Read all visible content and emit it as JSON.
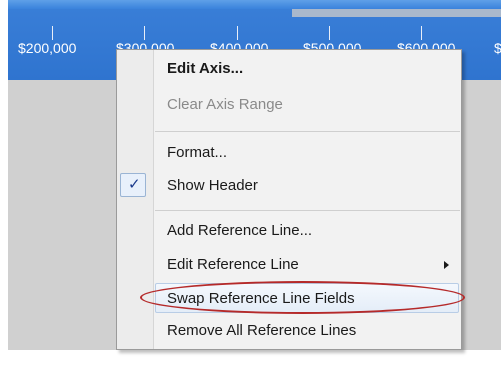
{
  "axis": {
    "ticks": [
      "$200,000",
      "$300,000",
      "$400,000",
      "$500,000",
      "$600,000",
      "$"
    ]
  },
  "menu": {
    "items": [
      {
        "label": "Edit Axis...",
        "style": "bold"
      },
      {
        "label": "Clear Axis Range",
        "style": "disabled"
      },
      {
        "label": "Format..."
      },
      {
        "label": "Show Header",
        "checked": true
      },
      {
        "label": "Add Reference Line..."
      },
      {
        "label": "Edit Reference Line",
        "submenu": true
      },
      {
        "label": "Swap Reference Line Fields",
        "highlighted": true
      },
      {
        "label": "Remove All Reference Lines"
      }
    ],
    "check_glyph": "✓"
  },
  "colors": {
    "axis_blue": "#2f74cf",
    "annotation_red": "#b52a2a",
    "background_gray": "#d0d0d0"
  }
}
